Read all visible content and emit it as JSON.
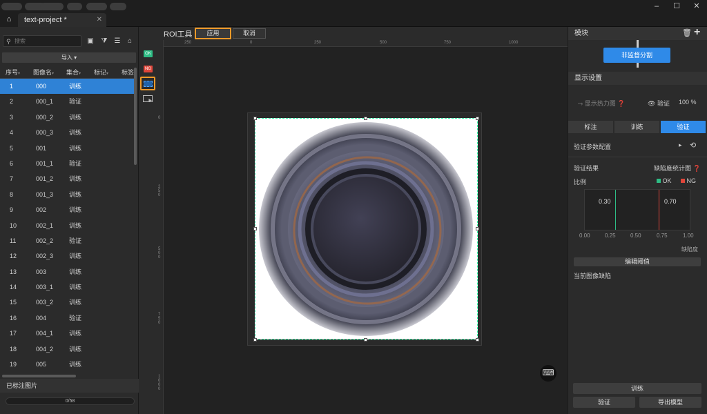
{
  "app": {
    "project_tab": "text-project *"
  },
  "left": {
    "search_placeholder": "搜索",
    "import_label": "导入 ▾",
    "columns": [
      "序号",
      "图像名",
      "集合",
      "标记",
      "标签"
    ],
    "rows": [
      {
        "idx": "1",
        "name": "000",
        "set": "训练"
      },
      {
        "idx": "2",
        "name": "000_1",
        "set": "验证"
      },
      {
        "idx": "3",
        "name": "000_2",
        "set": "训练"
      },
      {
        "idx": "4",
        "name": "000_3",
        "set": "训练"
      },
      {
        "idx": "5",
        "name": "001",
        "set": "训练"
      },
      {
        "idx": "6",
        "name": "001_1",
        "set": "验证"
      },
      {
        "idx": "7",
        "name": "001_2",
        "set": "训练"
      },
      {
        "idx": "8",
        "name": "001_3",
        "set": "训练"
      },
      {
        "idx": "9",
        "name": "002",
        "set": "训练"
      },
      {
        "idx": "10",
        "name": "002_1",
        "set": "训练"
      },
      {
        "idx": "11",
        "name": "002_2",
        "set": "验证"
      },
      {
        "idx": "12",
        "name": "002_3",
        "set": "训练"
      },
      {
        "idx": "13",
        "name": "003",
        "set": "训练"
      },
      {
        "idx": "14",
        "name": "003_1",
        "set": "训练"
      },
      {
        "idx": "15",
        "name": "003_2",
        "set": "训练"
      },
      {
        "idx": "16",
        "name": "004",
        "set": "验证"
      },
      {
        "idx": "17",
        "name": "004_1",
        "set": "训练"
      },
      {
        "idx": "18",
        "name": "004_2",
        "set": "训练"
      },
      {
        "idx": "19",
        "name": "005",
        "set": "训练"
      }
    ],
    "annotated_label": "已标注图片",
    "progress_text": "0/58"
  },
  "toolstrip": {
    "ok_badge": "OK",
    "ng_badge": "NG"
  },
  "roibar": {
    "title": "ROI工具",
    "apply": "应用",
    "cancel": "取消"
  },
  "ruler": {
    "top": [
      "250",
      "0",
      "250",
      "500",
      "750",
      "1000"
    ],
    "left": [
      "0",
      "250",
      "500",
      "750",
      "1000"
    ]
  },
  "right": {
    "module_header": "模块",
    "module_button": "非监督分割",
    "display_header": "显示设置",
    "heatmap_label": "显示热力图",
    "eye_label": "验证",
    "eye_percent": "100 %",
    "tabs": [
      "标注",
      "训练",
      "验证"
    ],
    "verify_params": "验证参数配置",
    "verify_result": "验证结果",
    "defect_stats": "缺陷度统计图",
    "ratio": "比例",
    "ok_label": "OK",
    "ng_label": "NG",
    "hist_left": "0.30",
    "hist_right": "0.70",
    "axis_ticks": [
      "0.00",
      "0.25",
      "0.50",
      "0.75",
      "1.00"
    ],
    "axis_label": "缺陷度",
    "edit_threshold": "编辑阈值",
    "current_defect": "当前图像缺陷",
    "train_button": "训练",
    "verify_button": "验证",
    "export_button": "导出模型"
  },
  "colors": {
    "accent": "#2f8ae8",
    "highlight": "#f09a29",
    "ok": "#2ebd85",
    "ng": "#e0463a"
  }
}
